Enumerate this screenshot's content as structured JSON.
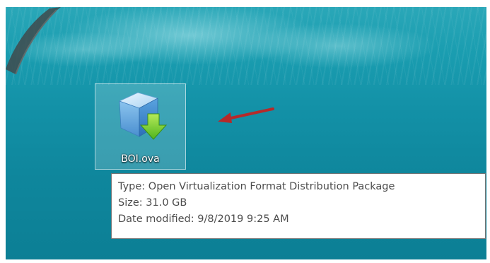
{
  "desktop": {
    "icon": {
      "label": "BOI.ova",
      "icon_name": "ova-package-download-icon"
    },
    "annotation_arrow_color": "#c0392b",
    "tooltip": {
      "type_line": "Type: Open Virtualization Format Distribution Package",
      "size_line": "Size: 31.0 GB",
      "date_line": "Date modified: 9/8/2019 9:25 AM"
    }
  }
}
